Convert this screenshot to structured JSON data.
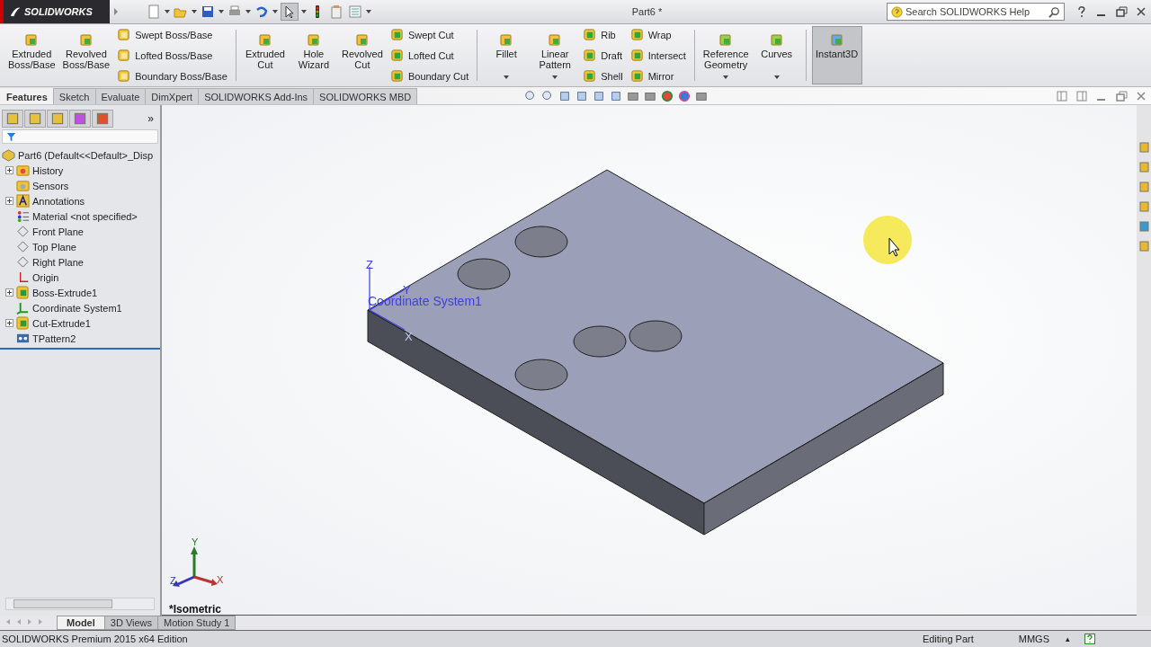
{
  "window": {
    "logo": "SOLIDWORKS",
    "title": "Part6 *",
    "search": {
      "placeholder": "Search SOLIDWORKS Help"
    }
  },
  "ribbon": {
    "groups": [
      {
        "items": [
          {
            "kind": "large",
            "label": "Extruded\nBoss/Base",
            "dropdown": false,
            "pressed": false
          },
          {
            "kind": "large",
            "label": "Revolved\nBoss/Base",
            "dropdown": false,
            "pressed": false
          },
          {
            "kind": "stack",
            "labels": [
              "Swept Boss/Base",
              "Lofted Boss/Base",
              "Boundary Boss/Base"
            ]
          }
        ]
      },
      {
        "items": [
          {
            "kind": "large",
            "label": "Extruded\nCut",
            "dropdown": false,
            "pressed": false
          },
          {
            "kind": "large",
            "label": "Hole\nWizard",
            "dropdown": false,
            "pressed": false
          },
          {
            "kind": "large",
            "label": "Revolved\nCut",
            "dropdown": false,
            "pressed": false
          },
          {
            "kind": "stack",
            "labels": [
              "Swept Cut",
              "Lofted Cut",
              "Boundary Cut"
            ]
          }
        ]
      },
      {
        "items": [
          {
            "kind": "large",
            "label": "Fillet",
            "dropdown": true,
            "pressed": false
          },
          {
            "kind": "large",
            "label": "Linear\nPattern",
            "dropdown": true,
            "pressed": false
          },
          {
            "kind": "stack",
            "labels": [
              "Rib",
              "Draft",
              "Shell"
            ]
          },
          {
            "kind": "stack",
            "labels": [
              "Wrap",
              "Intersect",
              "Mirror"
            ]
          }
        ]
      },
      {
        "items": [
          {
            "kind": "large",
            "label": "Reference\nGeometry",
            "dropdown": true,
            "pressed": false
          },
          {
            "kind": "large",
            "label": "Curves",
            "dropdown": true,
            "pressed": false
          }
        ]
      },
      {
        "items": [
          {
            "kind": "large",
            "label": "Instant3D",
            "dropdown": false,
            "pressed": true
          }
        ]
      }
    ]
  },
  "tabs": [
    {
      "label": "Features",
      "selected": true
    },
    {
      "label": "Sketch",
      "selected": false
    },
    {
      "label": "Evaluate",
      "selected": false
    },
    {
      "label": "DimXpert",
      "selected": false
    },
    {
      "label": "SOLIDWORKS Add-Ins",
      "selected": false
    },
    {
      "label": "SOLIDWORKS MBD",
      "selected": false
    }
  ],
  "feature_tree": {
    "more": "»",
    "root": "Part6  (Default<<Default>_Disp",
    "items": [
      {
        "kind": "folder",
        "label": "History",
        "has_children": true
      },
      {
        "kind": "sensor",
        "label": "Sensors",
        "has_children": false
      },
      {
        "kind": "annotations",
        "label": "Annotations",
        "has_children": true
      },
      {
        "kind": "material",
        "label": "Material <not specified>",
        "has_children": false
      },
      {
        "kind": "plane",
        "label": "Front Plane",
        "has_children": false
      },
      {
        "kind": "plane",
        "label": "Top Plane",
        "has_children": false
      },
      {
        "kind": "plane",
        "label": "Right Plane",
        "has_children": false
      },
      {
        "kind": "origin",
        "label": "Origin",
        "has_children": false
      },
      {
        "kind": "feature",
        "label": "Boss-Extrude1",
        "has_children": true
      },
      {
        "kind": "coordsys",
        "label": "Coordinate System1",
        "has_children": false
      },
      {
        "kind": "feature",
        "label": "Cut-Extrude1",
        "has_children": true
      },
      {
        "kind": "pattern",
        "label": "TPattern2",
        "has_children": false
      }
    ]
  },
  "viewport": {
    "coordinate_system": {
      "label": "Coordinate System1",
      "axes": [
        "Z",
        "Y",
        "X"
      ]
    },
    "triad": [
      "Y",
      "Z",
      "X"
    ],
    "view_name": "*Isometric"
  },
  "bottom_tabs": [
    {
      "label": "Model",
      "selected": true
    },
    {
      "label": "3D Views",
      "selected": false
    },
    {
      "label": "Motion Study 1",
      "selected": false
    }
  ],
  "status_bar": {
    "edition": "SOLIDWORKS Premium 2015 x64 Edition",
    "mode": "Editing Part",
    "units": "MMGS",
    "caret": "▴"
  }
}
